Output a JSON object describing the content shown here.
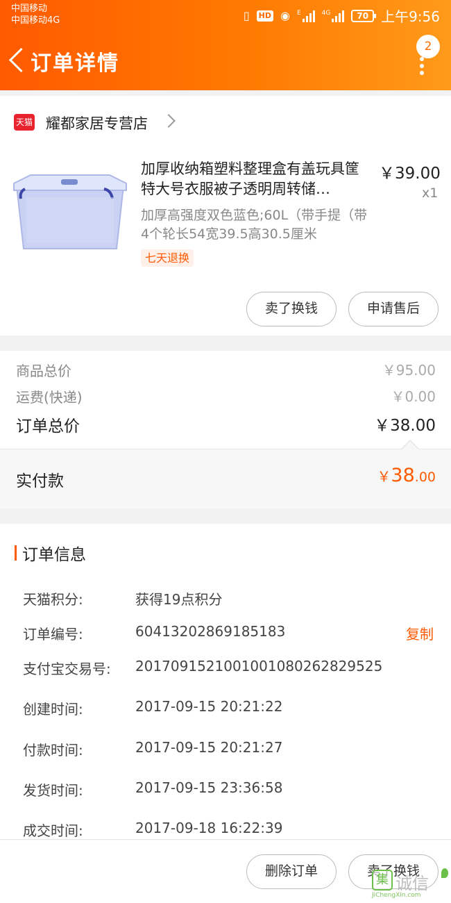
{
  "status_bar": {
    "carrier1": "中国移动",
    "carrier2": "中国移动4G",
    "hd": "HD",
    "net_e": "E",
    "net_4g": "4G",
    "battery": "70",
    "time": "上午9:56"
  },
  "header": {
    "title": "订单详情",
    "badge_count": "2"
  },
  "shop": {
    "logo_text": "天猫",
    "name": "耀都家居专营店"
  },
  "product": {
    "title": "加厚收纳箱塑料整理盒有盖玩具筐特大号衣服被子透明周转储…",
    "price": "￥39.00",
    "qty": "x1",
    "sku": "加厚高强度双色蓝色;60L（带手提（带4个轮长54宽39.5高30.5厘米",
    "tag": "七天退换",
    "btn_sell": "卖了换钱",
    "btn_after_sale": "申请售后"
  },
  "summary": {
    "goods_label": "商品总价",
    "goods_value": "￥95.00",
    "shipping_label": "运费(快递)",
    "shipping_value": "￥0.00",
    "order_total_label": "订单总价",
    "order_total_value": "￥38.00",
    "paid_label": "实付款",
    "paid_currency": "￥",
    "paid_int": "38",
    "paid_dec": ".00"
  },
  "order_info": {
    "title": "订单信息",
    "rows": [
      {
        "label": "天猫积分:",
        "value": "获得19点积分"
      },
      {
        "label": "订单编号:",
        "value": "60413202869185183"
      },
      {
        "label": "支付宝交易号:",
        "value": "2017091521001001080262829525"
      },
      {
        "label": "创建时间:",
        "value": "2017-09-15 20:21:22"
      },
      {
        "label": "付款时间:",
        "value": "2017-09-15 20:21:27"
      },
      {
        "label": "发货时间:",
        "value": "2017-09-15 23:36:58"
      },
      {
        "label": "成交时间:",
        "value": "2017-09-18 16:22:39"
      }
    ],
    "copy_label": "复制"
  },
  "bottom_bar": {
    "delete_label": "删除订单",
    "sell_label": "卖了换钱"
  },
  "watermark": {
    "box": "集",
    "text": "诚信",
    "sub": "JiChengXin.com"
  },
  "colors": {
    "accent": "#ff5a00",
    "header_gradient_start": "#ff5a00",
    "header_gradient_end": "#ff9a1a",
    "tmall_red": "#e8232e"
  }
}
